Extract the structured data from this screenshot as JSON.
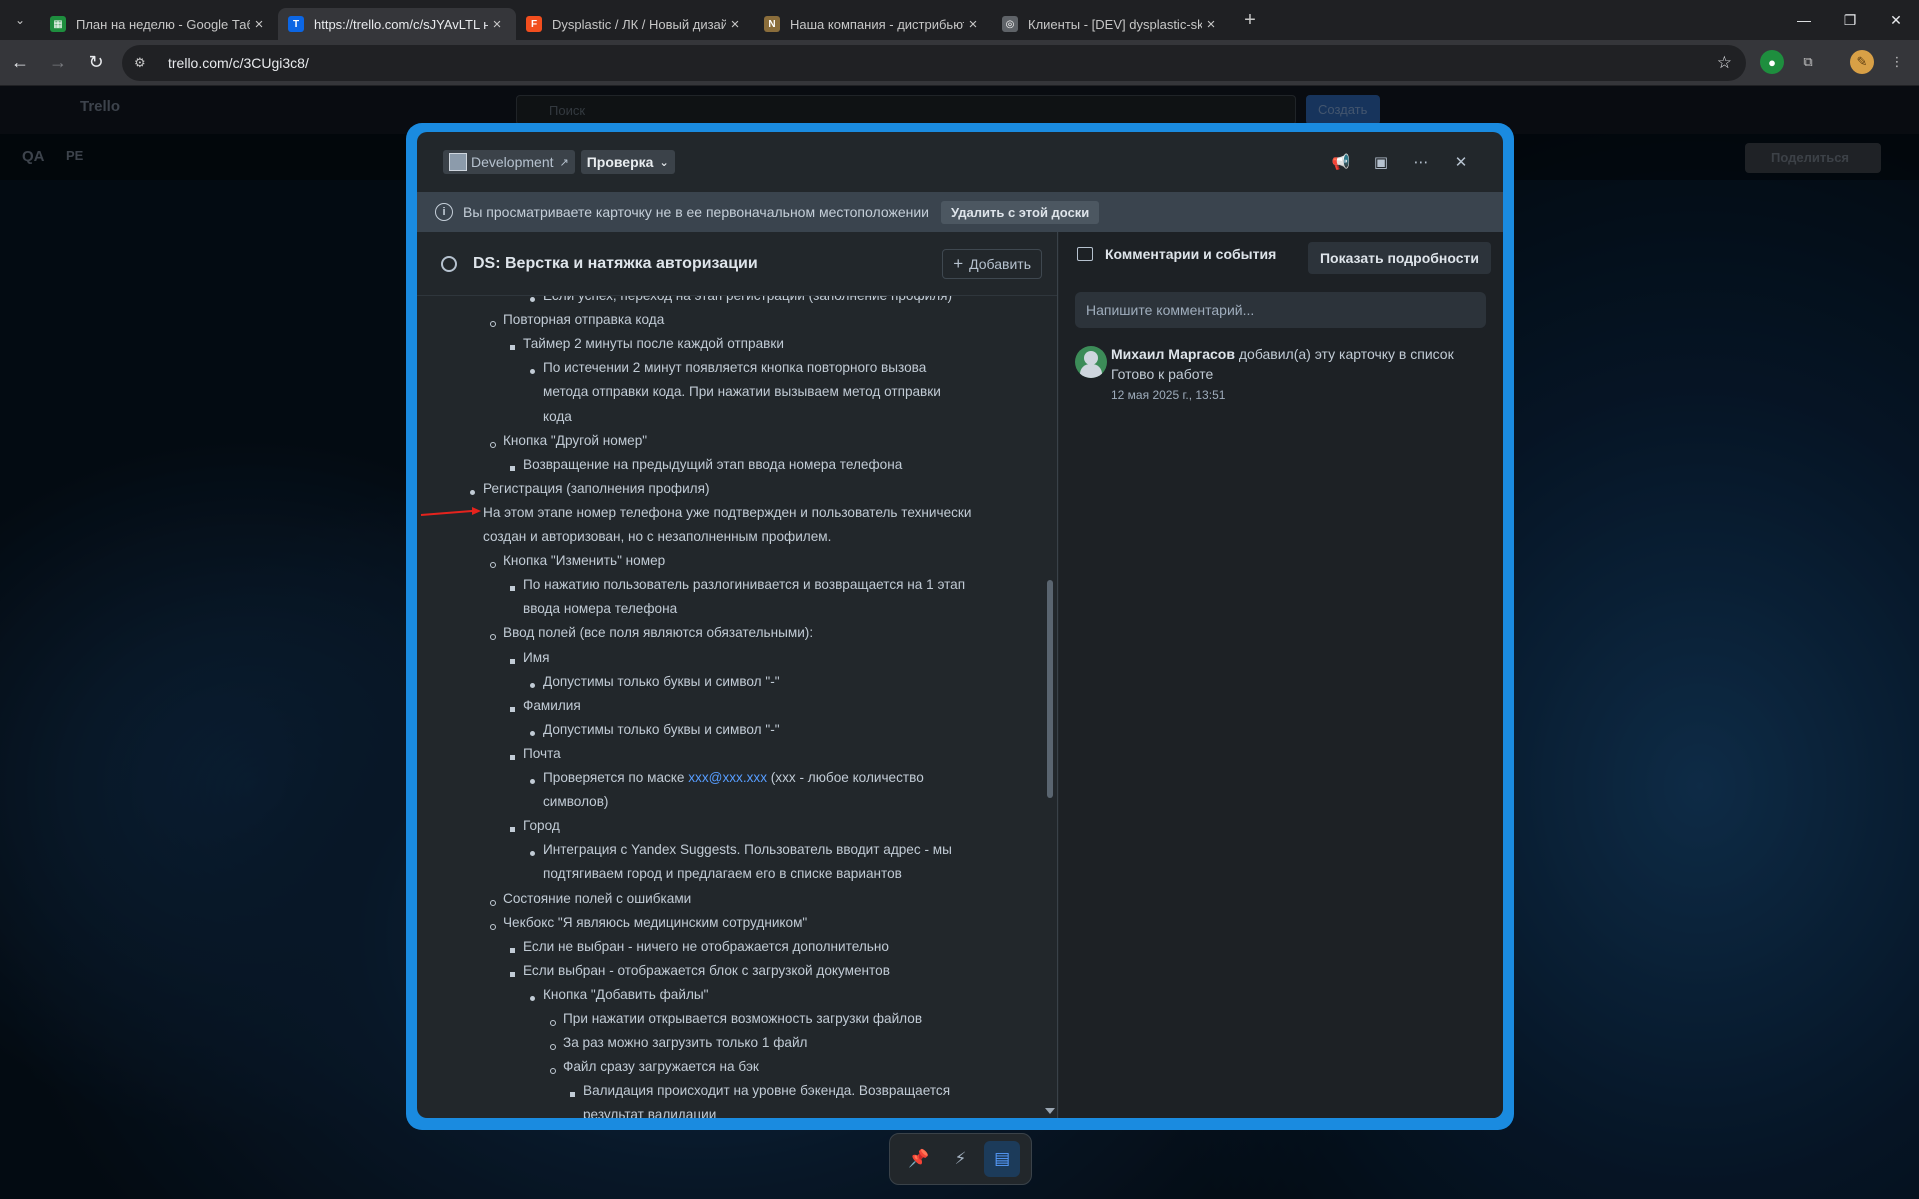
{
  "browser": {
    "tabs": [
      {
        "title": "План на неделю - Google Таб",
        "icon_color": "#1e8e3e",
        "icon_char": "▦"
      },
      {
        "title": "https://trello.com/c/sJYAvLTL н",
        "icon_color": "#0c66e4",
        "icon_char": "T"
      },
      {
        "title": "Dysplastic / ЛК / Новый дизай",
        "icon_color": "#f24e1e",
        "icon_char": "F"
      },
      {
        "title": "Наша компания - дистрибьют",
        "icon_color": "#8a6d3b",
        "icon_char": "N"
      },
      {
        "title": "Клиенты - [DEV] dysplastic-skir",
        "icon_color": "#5f6368",
        "icon_char": "◎"
      }
    ],
    "url": "trello.com/c/3CUgi3c8/"
  },
  "background": {
    "app_name": "Trello",
    "search_placeholder": "Поиск",
    "create_label": "Создать",
    "board_name": "QA",
    "board_view": "РЕ",
    "share_label": "Поделиться"
  },
  "modal": {
    "board_label": "Development",
    "list_label": "Проверка",
    "banner_text": "Вы просматриваете карточку не в ее первоначальном местоположении",
    "banner_button": "Удалить с этой доски",
    "card_title": "DS: Верстка и натяжка авторизации",
    "add_button": "Добавить",
    "description": [
      {
        "level": 3,
        "text": "Если успех, переход на этап регистрации (заполнение профиля)"
      },
      {
        "level": 1,
        "text": "Повторная отправка кода"
      },
      {
        "level": 2,
        "text": "Таймер 2 минуты после каждой отправки"
      },
      {
        "level": 3,
        "text": "По истечении 2 минут появляется кнопка повторного вызова"
      },
      {
        "level": 3,
        "text": "метода отправки кода. При нажатии вызываем метод отправки",
        "cont": true
      },
      {
        "level": 3,
        "text": "кода",
        "cont": true
      },
      {
        "level": 1,
        "text": "Кнопка \"Другой номер\""
      },
      {
        "level": 2,
        "text": "Возвращение на предыдущий этап ввода номера телефона"
      },
      {
        "level": 0,
        "text": "Регистрация (заполнения профиля)"
      },
      {
        "level": 0,
        "text": "На этом этапе номер телефона уже подтвержден и пользователь технически",
        "cont": true
      },
      {
        "level": 0,
        "text": "создан и авторизован, но с незаполненным профилем.",
        "cont": true
      },
      {
        "level": 1,
        "text": "Кнопка \"Изменить\" номер"
      },
      {
        "level": 2,
        "text": "По нажатию пользователь разлогинивается и возвращается на 1 этап"
      },
      {
        "level": 2,
        "text": "ввода номера телефона",
        "cont": true
      },
      {
        "level": 1,
        "text": "Ввод полей (все поля являются обязательными):"
      },
      {
        "level": 2,
        "text": "Имя"
      },
      {
        "level": 3,
        "text": "Допустимы только буквы и символ \"-\""
      },
      {
        "level": 2,
        "text": "Фамилия"
      },
      {
        "level": 3,
        "text": "Допустимы только буквы и символ \"-\""
      },
      {
        "level": 2,
        "text": "Почта"
      },
      {
        "level": 3,
        "text": "Проверяется по маске ",
        "link": "xxx@xxx.xxx",
        "after": " (xxx - любое количество"
      },
      {
        "level": 3,
        "text": "символов)",
        "cont": true
      },
      {
        "level": 2,
        "text": "Город"
      },
      {
        "level": 3,
        "text": "Интеграция с Yandex Suggests. Пользователь вводит адрес - мы"
      },
      {
        "level": 3,
        "text": "подтягиваем город и предлагаем его в списке вариантов",
        "cont": true
      },
      {
        "level": 1,
        "text": "Состояние полей с ошибками"
      },
      {
        "level": 1,
        "text": "Чекбокс \"Я являюсь медицинским сотрудником\""
      },
      {
        "level": 2,
        "text": "Если не выбран - ничего не отображается дополнительно"
      },
      {
        "level": 2,
        "text": "Если выбран - отображается блок с загрузкой документов"
      },
      {
        "level": 3,
        "text": "Кнопка \"Добавить файлы\""
      },
      {
        "level": 4,
        "text": "При нажатии открывается возможность загрузки файлов"
      },
      {
        "level": 4,
        "text": "За раз можно загрузить только 1 файл"
      },
      {
        "level": 4,
        "text": "Файл сразу загружается на бэк"
      },
      {
        "level": 5,
        "text": "Валидация происходит на уровне бэкенда. Возвращается"
      },
      {
        "level": 5,
        "text": "результат валидации",
        "cont": true
      }
    ],
    "activity_title": "Комментарии и события",
    "show_details": "Показать подробности",
    "comment_placeholder": "Напишите комментарий...",
    "activity": {
      "author": "Михаил Маргасов",
      "action": " добавил(а) эту карточку в список",
      "target": "Готово к работе",
      "time": "12 мая 2025 г., 13:51"
    }
  },
  "colors": {
    "accent": "#1a8be0",
    "link": "#579dff",
    "modal_bg": "#22272b"
  }
}
